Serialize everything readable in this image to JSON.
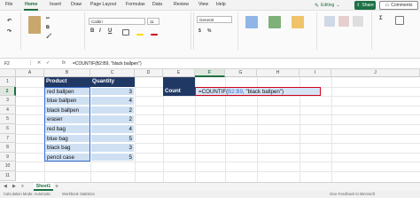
{
  "tabs": [
    "File",
    "Home",
    "Insert",
    "Draw",
    "Page Layout",
    "Formulas",
    "Data",
    "Review",
    "View",
    "Help"
  ],
  "active_tab": "Home",
  "editing_label": "Editing",
  "share_label": "Share",
  "comments_label": "Comments",
  "ribbon": {
    "font_name": "Calibri",
    "font_size": "11",
    "number_format": "General",
    "groups": [
      "Undo",
      "Clipboard",
      "Font",
      "Alignment",
      "Number",
      "Styles",
      "Cells",
      "Editing"
    ]
  },
  "formula_bar": {
    "name_box": "F2",
    "fx": "fx",
    "formula": "=COUNTIF(B2:B9, \"black ballpen\")"
  },
  "columns": [
    "A",
    "B",
    "C",
    "D",
    "E",
    "F",
    "G",
    "H",
    "I",
    "J"
  ],
  "rows": [
    "1",
    "2",
    "3",
    "4",
    "5",
    "6",
    "7",
    "8",
    "9",
    "10",
    "11"
  ],
  "table": {
    "headers": [
      "Product",
      "Quantity"
    ],
    "rows": [
      {
        "product": "red ballpen",
        "qty": "3"
      },
      {
        "product": "blue ballpen",
        "qty": "4"
      },
      {
        "product": "black ballpen",
        "qty": "2"
      },
      {
        "product": "eraser",
        "qty": "2"
      },
      {
        "product": "red bag",
        "qty": "4"
      },
      {
        "product": "blue bag",
        "qty": "5"
      },
      {
        "product": "black bag",
        "qty": "3"
      },
      {
        "product": "pencil case",
        "qty": "5"
      }
    ]
  },
  "count_label": "Count",
  "formula_cell": {
    "prefix": "=COUNTIF(",
    "ref": "B2:B9",
    "suffix": ", \"black ballpen\")"
  },
  "sheet_tab": "Sheet1",
  "status": {
    "calc": "Calculation Mode: Automatic",
    "stats": "Workbook Statistics",
    "feedback": "Give Feedback to Microsoft"
  },
  "colors": {
    "accent": "#1e6e41",
    "header_fill": "#203864",
    "data_fill": "#cfe0f3",
    "highlight": "#d0021b"
  }
}
